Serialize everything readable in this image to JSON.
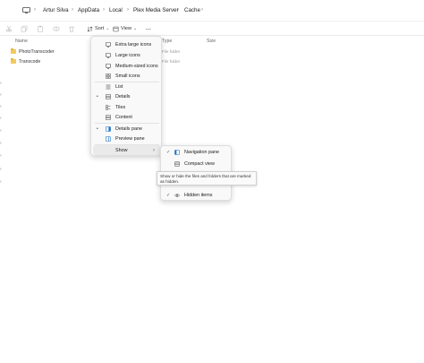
{
  "breadcrumb": [
    "Artur Silva",
    "AppData",
    "Local",
    "Plex Media Server",
    "Cache"
  ],
  "toolbar": {
    "sort_label": "Sort",
    "view_label": "View",
    "more_label": "..."
  },
  "columns": {
    "name": "Name",
    "type": "Type",
    "size": "Size"
  },
  "files": [
    {
      "name": "PhotoTranscoder",
      "type": "File folder"
    },
    {
      "name": "Transcode",
      "type": "File folder"
    }
  ],
  "view_menu": {
    "items": [
      {
        "label": "Extra large icons",
        "icon": "monitor-icon"
      },
      {
        "label": "Large icons",
        "icon": "monitor-icon"
      },
      {
        "label": "Medium-sized icons",
        "icon": "monitor-icon"
      },
      {
        "label": "Small icons",
        "icon": "grid-icon"
      },
      {
        "label": "List",
        "icon": "list-icon"
      },
      {
        "label": "Details",
        "icon": "details-icon",
        "checked": true
      },
      {
        "label": "Tiles",
        "icon": "tiles-icon"
      },
      {
        "label": "Content",
        "icon": "content-icon"
      },
      {
        "label": "Details pane",
        "icon": "details-pane-icon",
        "checked": true
      },
      {
        "label": "Preview pane",
        "icon": "preview-pane-icon"
      },
      {
        "label": "Show",
        "has_submenu": true
      }
    ]
  },
  "show_submenu": {
    "items": [
      {
        "label": "Navigation pane",
        "icon": "navigation-pane-icon",
        "checked": true
      },
      {
        "label": "Compact view",
        "icon": "compact-view-icon"
      },
      {
        "label": "Hidden items",
        "icon": "eye-icon",
        "checked": true
      }
    ]
  },
  "tooltip": "Show or hide the files and folders that are marked as hidden.",
  "accent": "#1a73c7"
}
